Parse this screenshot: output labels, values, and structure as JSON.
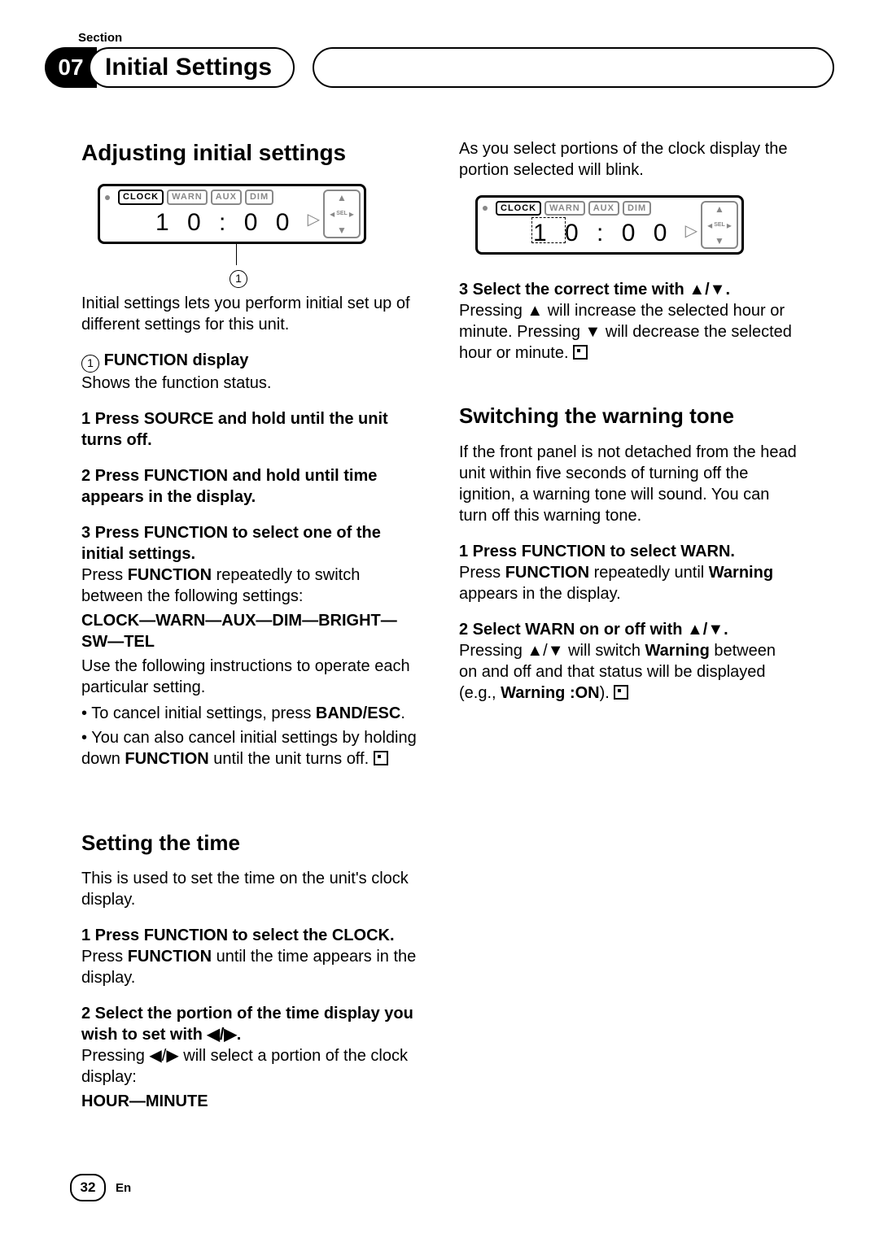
{
  "section_label": "Section",
  "section_number": "07",
  "chapter_title": "Initial Settings",
  "col1": {
    "h_adjusting": "Adjusting initial settings",
    "lcd1": {
      "tags": [
        "CLOCK",
        "WARN",
        "AUX",
        "DIM"
      ],
      "time": "1 0 : 0 0",
      "callout_num": "1"
    },
    "intro": "Initial settings lets you perform initial set up of different settings for this unit.",
    "fn_display_label": "FUNCTION display",
    "fn_display_text": "Shows the function status.",
    "step1": "1   Press SOURCE and hold until the unit turns off.",
    "step2": "2   Press FUNCTION and hold until time appears in the display.",
    "step3": "3   Press FUNCTION to select one of the initial settings.",
    "step3_body1a": "Press ",
    "step3_body1b": " repeatedly to switch between the following settings:",
    "chain": "CLOCK—WARN—AUX—DIM—BRIGHT—SW—TEL",
    "use_following": "Use the following instructions to operate each particular setting.",
    "bul1a": "• To cancel initial settings, press ",
    "bul1b": ".",
    "bul2a": "• You can also cancel initial settings by holding down ",
    "bul2b": " until the unit turns off.  ",
    "h_setting_time": "Setting the time",
    "setting_time_intro": "This is used to set the time on the unit's clock display.",
    "st_step1": "1   Press FUNCTION to select the CLOCK.",
    "st_step1_body_a": "Press ",
    "st_step1_body_b": " until the time appears in the display.",
    "FUNCTION": "FUNCTION",
    "BANDESC": "BAND/ESC"
  },
  "col2": {
    "st_step2a": "2   Select the portion of the time display you wish to set with ",
    "st_step2b": ".",
    "st_step2_body_a": "Pressing ",
    "st_step2_body_b": " will select a portion of the clock display:",
    "hm": "HOUR—MINUTE",
    "hm_body": "As you select portions of the clock display the portion selected will blink.",
    "lcd2": {
      "tags": [
        "CLOCK",
        "WARN",
        "AUX",
        "DIM"
      ],
      "time": "1 0 : 0 0"
    },
    "st_step3a": "3   Select the correct time with ",
    "st_step3b": ".",
    "st_step3_body_a": "Pressing ",
    "st_step3_body_b": " will increase the selected hour or minute. Pressing ",
    "st_step3_body_c": " will decrease the selected hour or minute.  ",
    "h_warning": "Switching the warning tone",
    "warning_intro": "If the front panel is not detached from the head unit within five seconds of turning off the ignition, a warning tone will sound. You can turn off this warning tone.",
    "w_step1": "1   Press FUNCTION to select WARN.",
    "w_step1_body_a": "Press ",
    "w_step1_body_b": " repeatedly until ",
    "w_step1_body_c": " appears in the display.",
    "Warning": "Warning",
    "w_step2a": "2   Select WARN on or off with ",
    "w_step2b": ".",
    "w_step2_body_a": "Pressing ",
    "w_step2_body_b": " will switch ",
    "w_step2_body_c": " between on and off and that status will be displayed (e.g., ",
    "WarningON": "Warning :ON",
    "w_step2_body_d": ").  "
  },
  "glyphs": {
    "left": "◀",
    "right": "▶",
    "up": "▲",
    "down": "▼",
    "lr": "◀/▶",
    "ud": "▲/▼"
  },
  "footer": {
    "page": "32",
    "lang": "En"
  }
}
